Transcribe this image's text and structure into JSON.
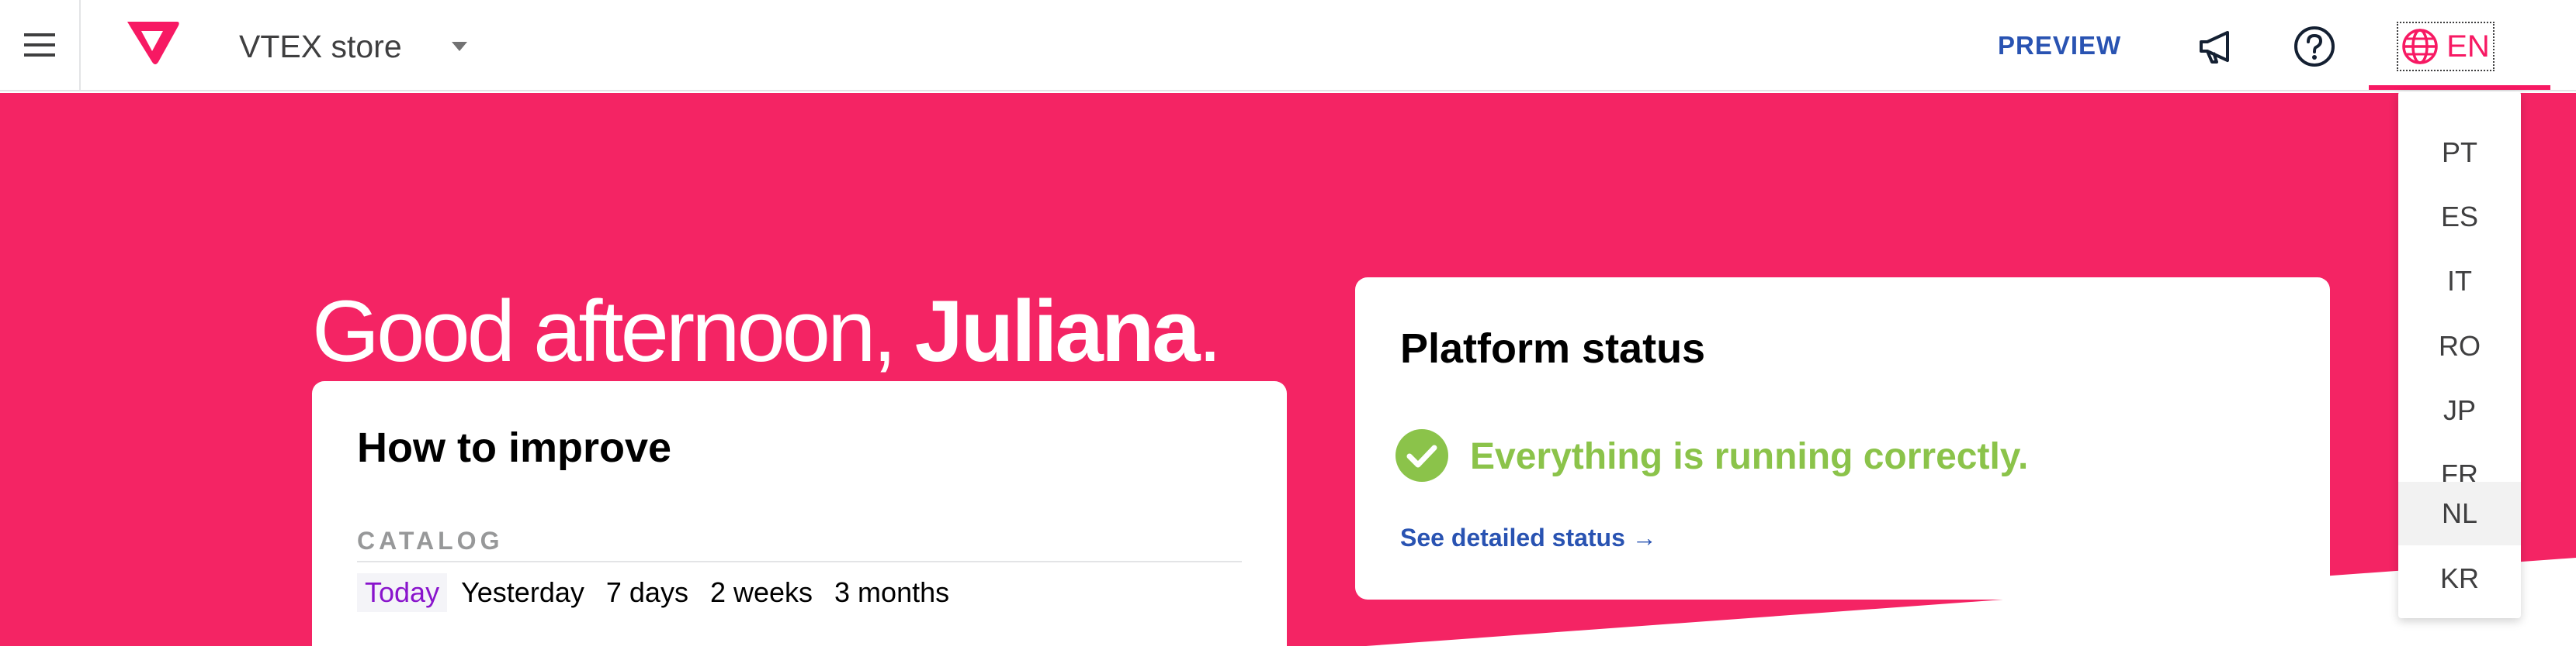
{
  "topbar": {
    "store_name": "VTEX store",
    "preview_label": "PREVIEW",
    "language_current": "EN",
    "icons": {
      "menu": "hamburger-menu-icon",
      "logo": "vtex-logo-icon",
      "caret": "caret-down-icon",
      "announcements": "megaphone-icon",
      "help": "help-circle-icon",
      "language": "globe-icon"
    }
  },
  "greeting": {
    "prefix": "Good afternoon, ",
    "name": "Juliana",
    "suffix": "."
  },
  "improve_card": {
    "title": "How to improve",
    "section_label": "CATALOG",
    "periods": [
      "Today",
      "Yesterday",
      "7 days",
      "2 weeks",
      "3 months"
    ],
    "active_period": "Today"
  },
  "status_card": {
    "title": "Platform status",
    "message": "Everything is running correctly.",
    "link_label": "See detailed status →"
  },
  "language_menu": {
    "options": [
      "PT",
      "ES",
      "IT",
      "RO",
      "JP",
      "FR",
      "NL",
      "KR"
    ],
    "hovered": "NL"
  },
  "colors": {
    "brand_pink": "#f71963",
    "hero_background": "#f42464",
    "link_blue": "#2953b2",
    "success_green": "#8bc34a",
    "active_purple": "#8914cc"
  }
}
